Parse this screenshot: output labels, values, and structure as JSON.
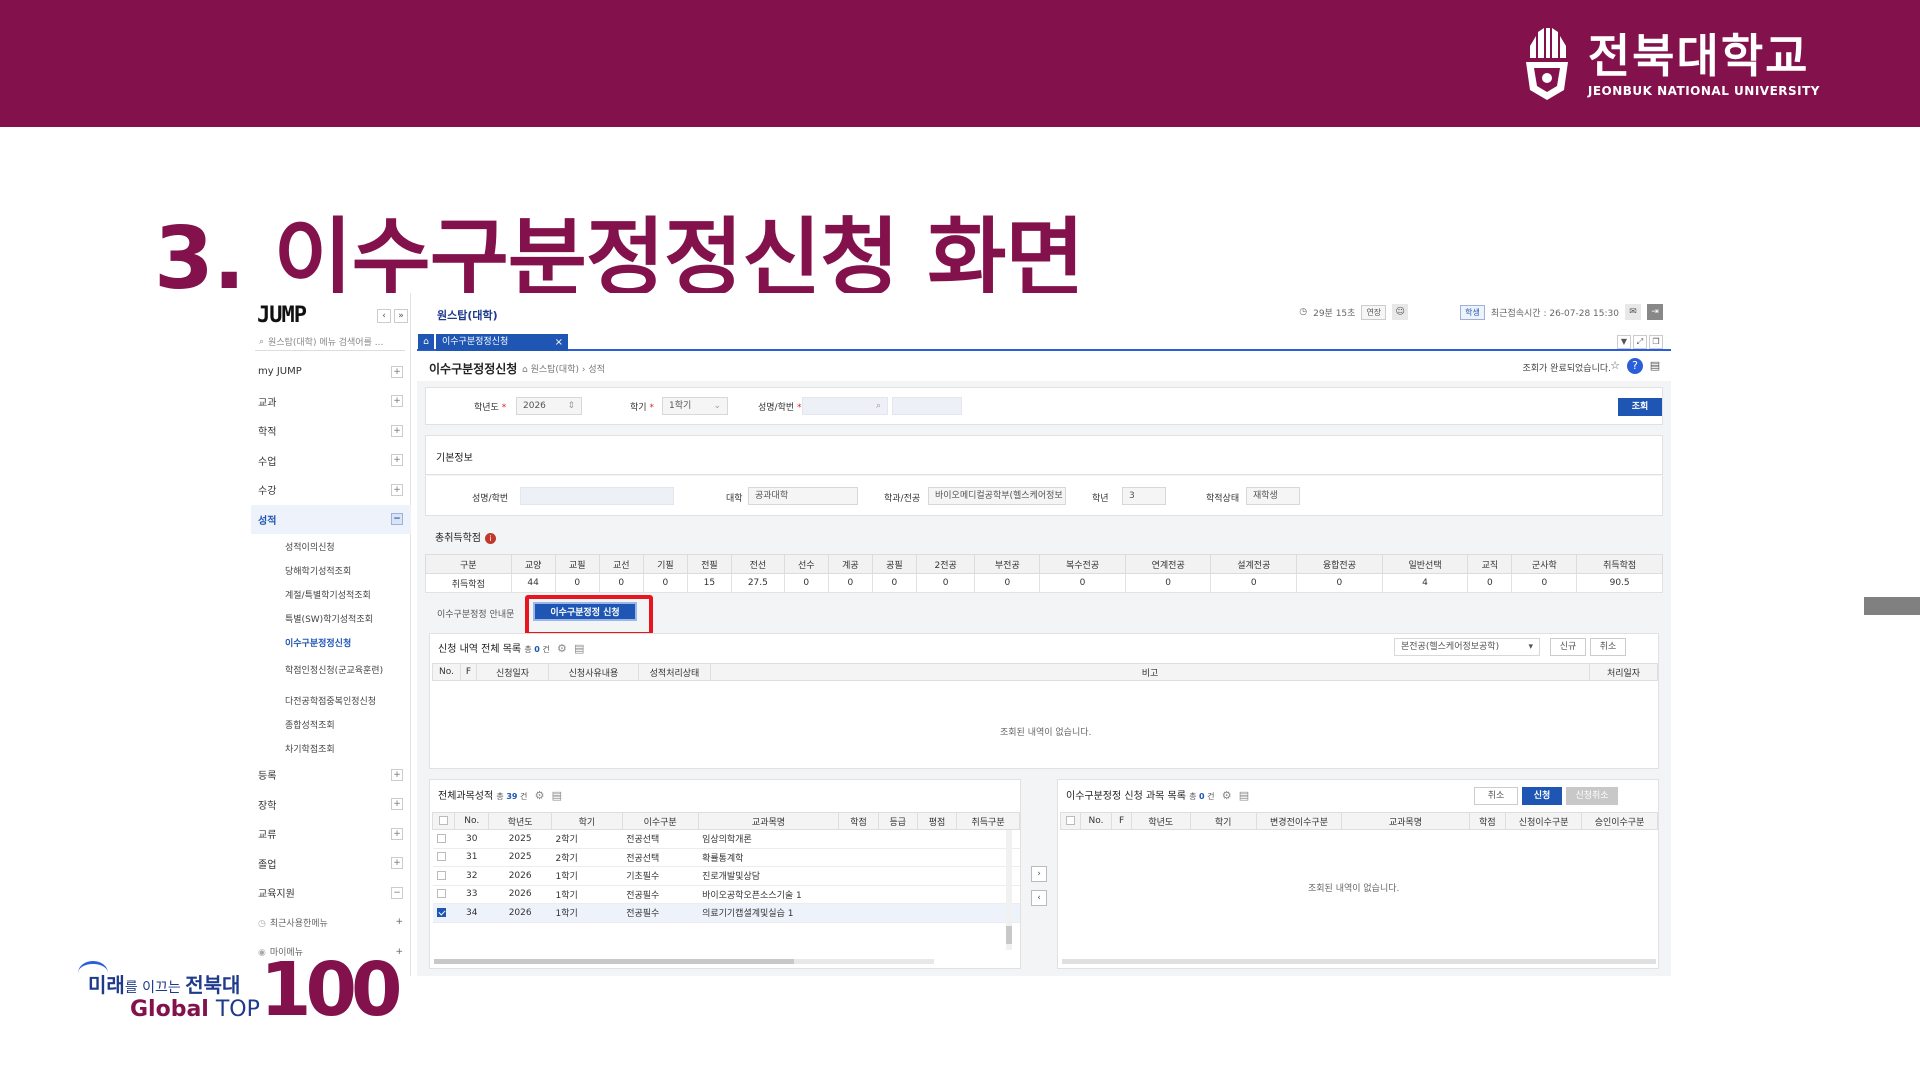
{
  "slide": {
    "title": "3. 이수구분정정신청 화면",
    "logo_ko": "전북대학교",
    "logo_en": "JEONBUK NATIONAL UNIVERSITY",
    "slogan_a": "미래",
    "slogan_b": "를 이끄는 ",
    "slogan_c": "전북대",
    "slogan_d": "Global",
    "slogan_e": " TOP",
    "slogan_num": "100"
  },
  "sidebar": {
    "logo": "JUMP",
    "search_placeholder": "원스탑(대학) 메뉴 검색어를 ...",
    "menus": [
      {
        "label": "my JUMP",
        "toggle": "+"
      },
      {
        "label": "교과",
        "toggle": "+"
      },
      {
        "label": "학적",
        "toggle": "+"
      },
      {
        "label": "수업",
        "toggle": "+"
      },
      {
        "label": "수강",
        "toggle": "+"
      },
      {
        "label": "성적",
        "toggle": "−"
      }
    ],
    "submenus": [
      "성적이의신청",
      "당해학기성적조회",
      "계절/특별학기성적조회",
      "특별(SW)학기성적조회",
      "이수구분정정신청",
      "학점인정신청(군교육훈련)",
      "다전공학점중복인정신청",
      "종합성적조회",
      "차기학점조회"
    ],
    "menus2": [
      {
        "label": "등록",
        "toggle": "+"
      },
      {
        "label": "장학",
        "toggle": "+"
      },
      {
        "label": "교류",
        "toggle": "+"
      },
      {
        "label": "졸업",
        "toggle": "+"
      },
      {
        "label": "교육지원",
        "toggle": "−"
      }
    ],
    "recent": "최근사용한메뉴",
    "mymenu": "마이메뉴"
  },
  "topbar": {
    "crumb": "원스탑(대학)",
    "timer": "29분 15초",
    "extend": "연장",
    "role": "학생",
    "last_login": "최근접속시간 : 26-07-28 15:30"
  },
  "tab": {
    "label": "이수구분정정신청"
  },
  "page": {
    "title": "이수구분정정신청",
    "crumb": "원스탑(대학) › 성적",
    "status": "조회가 완료되었습니다."
  },
  "search": {
    "year_label": "학년도",
    "year": "2026",
    "term_label": "학기",
    "term": "1학기",
    "name_label": "성명/학번",
    "search_btn": "조회"
  },
  "basic": {
    "title": "기본정보",
    "name_label": "성명/학번",
    "college_label": "대학",
    "college": "공과대학",
    "dept_label": "학과/전공",
    "dept": "바이오메디컬공학부(헬스케어정보",
    "grade_label": "학년",
    "grade": "3",
    "status_label": "학적상태",
    "status": "재학생"
  },
  "credits": {
    "title": "총취득학점",
    "headers": [
      "구분",
      "교양",
      "교필",
      "교선",
      "기필",
      "전필",
      "전선",
      "선수",
      "계공",
      "공필",
      "2전공",
      "부전공",
      "복수전공",
      "연계전공",
      "설계전공",
      "융합전공",
      "일반선택",
      "교직",
      "군사학",
      "취득학점"
    ],
    "row": [
      "취득학점",
      "44",
      "0",
      "0",
      "0",
      "15",
      "27.5",
      "0",
      "0",
      "0",
      "0",
      "0",
      "0",
      "0",
      "0",
      "0",
      "4",
      "0",
      "0",
      "90.5"
    ]
  },
  "subtabs": {
    "guide": "이수구분정정 안내문",
    "apply": "이수구분정정 신청"
  },
  "history": {
    "title": "신청 내역 전체 목록",
    "total_prefix": "총",
    "count": "0",
    "unit": "건",
    "select": "본전공(헬스케어정보공학)",
    "new_btn": "신규",
    "cancel_btn": "취소",
    "headers": [
      "No.",
      "F",
      "신청일자",
      "신청사유내용",
      "성적처리상태",
      "비고",
      "처리일자"
    ],
    "empty": "조회된 내역이 없습니다."
  },
  "grades": {
    "title": "전체과목성적",
    "total_prefix": "총",
    "count": "39",
    "unit": "건",
    "headers": [
      "No.",
      "학년도",
      "학기",
      "이수구분",
      "교과목명",
      "학점",
      "등급",
      "평점",
      "취득구분"
    ],
    "rows": [
      {
        "no": "30",
        "year": "2025",
        "term": "2학기",
        "type": "전공선택",
        "name": "임상의학개론",
        "checked": false
      },
      {
        "no": "31",
        "year": "2025",
        "term": "2학기",
        "type": "전공선택",
        "name": "확률통계학",
        "checked": false
      },
      {
        "no": "32",
        "year": "2026",
        "term": "1학기",
        "type": "기초필수",
        "name": "진로개발및상담",
        "checked": false
      },
      {
        "no": "33",
        "year": "2026",
        "term": "1학기",
        "type": "전공필수",
        "name": "바이오공학오픈소스기술 1",
        "checked": false
      },
      {
        "no": "34",
        "year": "2026",
        "term": "1학기",
        "type": "전공필수",
        "name": "의료기기캡셜계및실습 1",
        "checked": true
      }
    ]
  },
  "apply": {
    "title": "이수구분정정 신청 과목 목록",
    "total_prefix": "총",
    "count": "0",
    "unit": "건",
    "cancel_btn": "취소",
    "apply_btn": "신청",
    "apply_cancel_btn": "신청취소",
    "headers": [
      "No.",
      "F",
      "학년도",
      "학기",
      "변경전이수구분",
      "교과목명",
      "학점",
      "신청이수구분",
      "승인이수구분"
    ],
    "empty": "조회된 내역이 없습니다."
  },
  "colors": {
    "brand": "#82114c",
    "accent": "#1f56b3",
    "highlight": "#e8141e"
  }
}
